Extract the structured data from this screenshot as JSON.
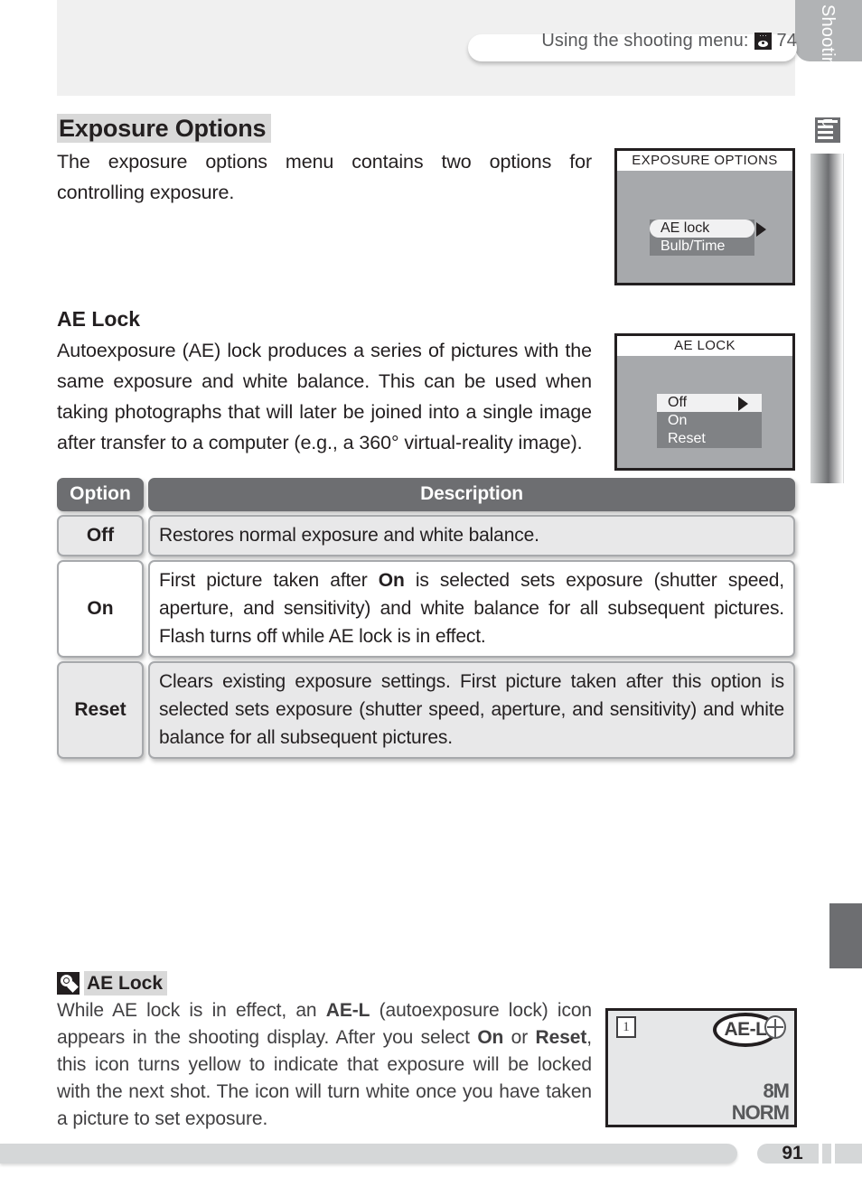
{
  "header": {
    "running_head": "Using the shooting menu:",
    "icon": "camera-menu-icon",
    "page_ref": "74"
  },
  "section": {
    "title": "Exposure Options",
    "intro": "The exposure options menu contains two options for controlling exposure."
  },
  "subsection": {
    "title": "AE Lock",
    "body": "Autoexposure (AE) lock produces a series of pictures with the same exposure and white balance.   This can be used when taking photographs that will later be joined into a single image after transfer to a computer (e.g., a 360° virtual-reality image)."
  },
  "lcd_exposure_options": {
    "title": "EXPOSURE OPTIONS",
    "items": [
      {
        "label": "AE lock",
        "selected": true
      },
      {
        "label": "Bulb/Time",
        "selected": false
      }
    ]
  },
  "lcd_ae_lock": {
    "title": "AE LOCK",
    "items": [
      {
        "label": "Off",
        "selected": true
      },
      {
        "label": "On",
        "selected": false
      },
      {
        "label": "Reset",
        "selected": false
      }
    ]
  },
  "table": {
    "headers": {
      "option": "Option",
      "description": "Description"
    },
    "rows": [
      {
        "option": "Off",
        "description_parts": [
          {
            "text": "Restores normal exposure and white balance.",
            "bold": false
          }
        ]
      },
      {
        "option": "On",
        "description_parts": [
          {
            "text": "First picture taken after ",
            "bold": false
          },
          {
            "text": "On",
            "bold": true
          },
          {
            "text": " is selected sets exposure (shutter speed, aperture, and sensitivity) and white balance for all subsequent pictures.  Flash turns off while AE lock is in effect.",
            "bold": false
          }
        ]
      },
      {
        "option": "Reset",
        "description_parts": [
          {
            "text": "Clears existing exposure settings.  First picture taken after this option is selected sets exposure (shutter speed, aperture, and sensitivity) and white balance for all subsequent pictures.",
            "bold": false
          }
        ]
      }
    ]
  },
  "note": {
    "icon": "lightbulb-tip-icon",
    "title": "AE Lock",
    "body_parts": [
      {
        "text": "While AE lock is in effect, an ",
        "bold": false
      },
      {
        "text": "AE-L",
        "bold": true
      },
      {
        "text": " (autoexposure lock) icon appears in the shooting display.  After you select ",
        "bold": false
      },
      {
        "text": "On",
        "bold": true
      },
      {
        "text": " or ",
        "bold": false
      },
      {
        "text": "Reset",
        "bold": true
      },
      {
        "text": ", this icon turns yellow to indicate that exposure will be locked with the next shot.  The icon will turn white once you have taken a picture to set exposure.",
        "bold": false
      }
    ]
  },
  "shooting_display": {
    "frame_count": "1",
    "ae_lock_badge": "AE-L",
    "flash_icon": "sun-white-balance-icon",
    "image_size": "8M",
    "image_quality": "NORM"
  },
  "side_tab": {
    "label": "Menu Guide—The Shooting Menu",
    "icon": "menu-list-icon"
  },
  "footer": {
    "page_number": "91"
  },
  "colors": {
    "lcd_background": "#a7a9ac",
    "lcd_menu_block": "#808285",
    "table_header": "#6d6e71",
    "highlight": "#d9d9d9",
    "row_gray": "#e8e8e9",
    "ink": "#231f20"
  }
}
